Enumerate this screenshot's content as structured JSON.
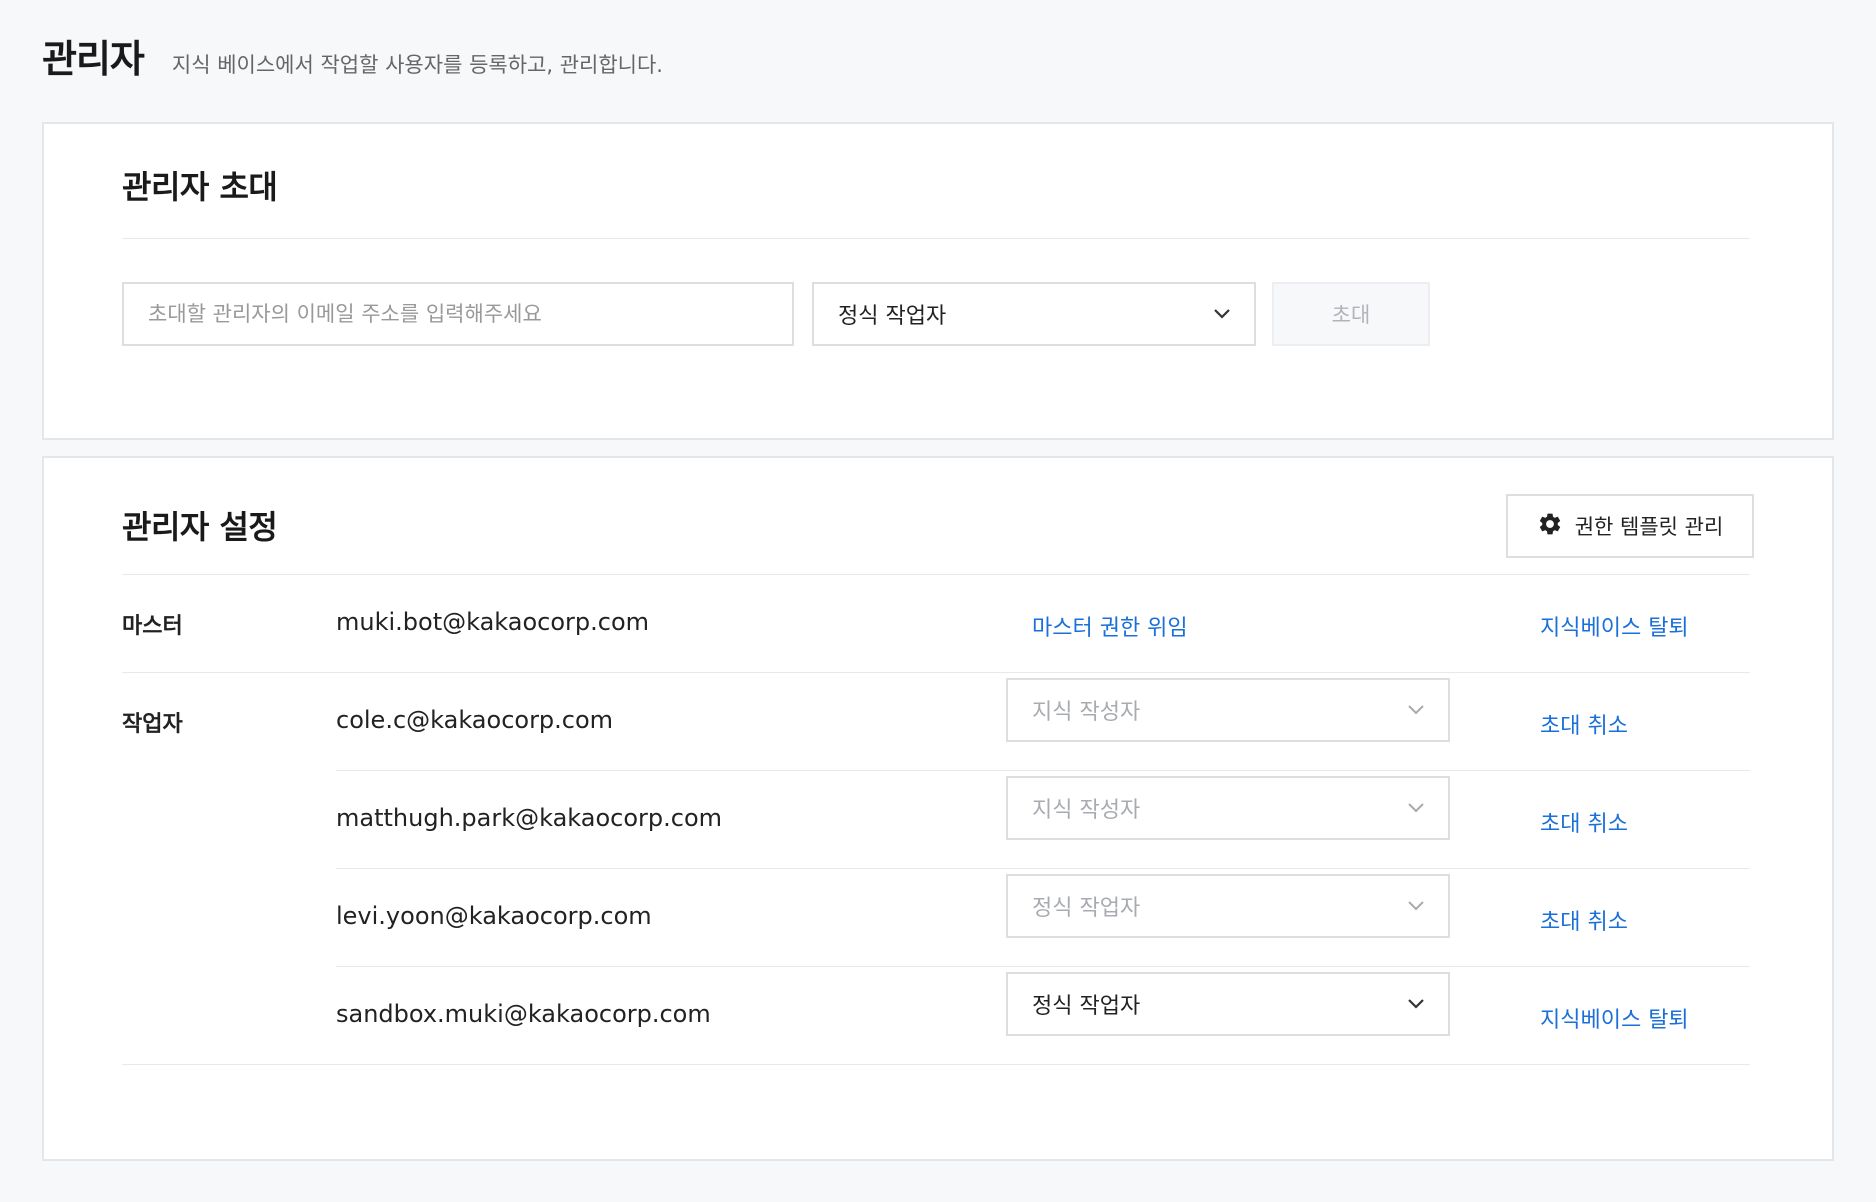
{
  "header": {
    "title": "관리자",
    "description": "지식 베이스에서 작업할 사용자를 등록하고, 관리합니다."
  },
  "invite": {
    "title": "관리자 초대",
    "email_placeholder": "초대할 관리자의 이메일 주소를 입력해주세요",
    "role_value": "정식 작업자",
    "invite_button": "초대"
  },
  "settings": {
    "title": "관리자 설정",
    "template_button": "권한 템플릿 관리",
    "master": {
      "label": "마스터",
      "email": "muki.bot@kakaocorp.com",
      "delegate_link": "마스터 권한 위임",
      "leave_link": "지식베이스 탈퇴"
    },
    "workers_label": "작업자",
    "workers": [
      {
        "email": "cole.c@kakaocorp.com",
        "role": "지식 작성자",
        "action": "초대 취소"
      },
      {
        "email": "matthugh.park@kakaocorp.com",
        "role": "지식 작성자",
        "action": "초대 취소"
      },
      {
        "email": "levi.yoon@kakaocorp.com",
        "role": "정식 작업자",
        "action": "초대 취소"
      },
      {
        "email": "sandbox.muki@kakaocorp.com",
        "role": "정식 작업자",
        "action": "지식베이스 탈퇴"
      }
    ]
  },
  "colors": {
    "link": "#1a6fd8",
    "background": "#f7f8fa",
    "border": "#e4e6ea",
    "disabled_text": "#a8abb0"
  }
}
